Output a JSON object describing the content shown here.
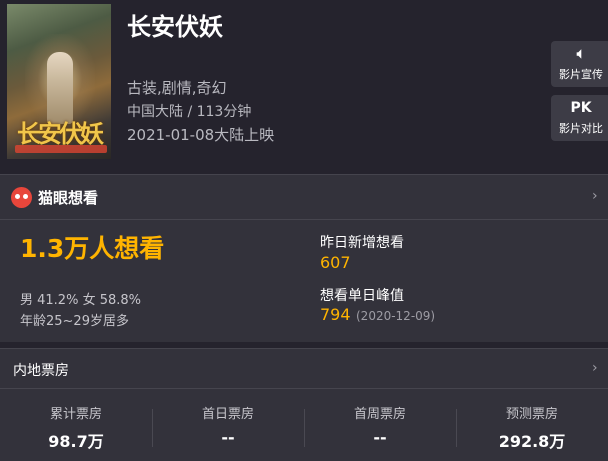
{
  "movie": {
    "title": "长安伏妖",
    "genres": "古装,剧情,奇幻",
    "region_duration": "中国大陆 / 113分钟",
    "release": "2021-01-08大陆上映",
    "poster_title": "长安伏妖"
  },
  "side_buttons": [
    {
      "icon": "speaker-icon",
      "icon_glyph": "🔈︎",
      "label": "影片宣传"
    },
    {
      "icon": "pk-icon",
      "icon_glyph": "PK",
      "label": "影片对比"
    }
  ],
  "want_panel": {
    "title": "猫眼想看",
    "total": "1.3万人想看",
    "gender": "男 41.2% 女 58.8%",
    "age": "年龄25~29岁居多",
    "yesterday_label": "昨日新增想看",
    "yesterday_value": "607",
    "peak_label": "想看单日峰值",
    "peak_value": "794",
    "peak_date": "(2020-12-09)"
  },
  "box_office": {
    "title": "内地票房",
    "cells": [
      {
        "label": "累计票房",
        "value": "98.7万"
      },
      {
        "label": "首日票房",
        "value": "--"
      },
      {
        "label": "首周票房",
        "value": "--"
      },
      {
        "label": "预测票房",
        "value": "292.8万"
      }
    ]
  },
  "colors": {
    "accent": "#ffb400",
    "background": "#25232d",
    "panel": "#33323b",
    "brand_red": "#e8463b"
  }
}
